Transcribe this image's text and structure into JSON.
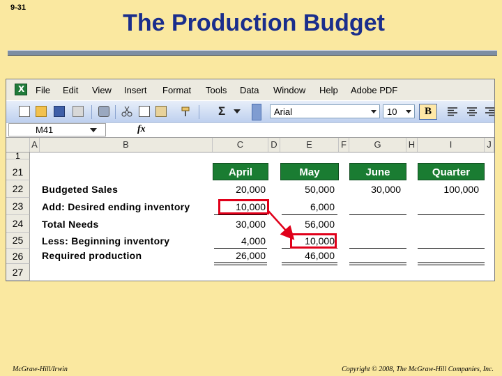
{
  "slide": {
    "number": "9-31",
    "title": "The Production Budget",
    "footer_left": "McGraw-Hill/Irwin",
    "footer_right": "Copyright © 2008, The McGraw-Hill Companies, Inc."
  },
  "menu": [
    "File",
    "Edit",
    "View",
    "Insert",
    "Format",
    "Tools",
    "Data",
    "Window",
    "Help",
    "Adobe PDF"
  ],
  "toolbar": {
    "font": "Arial",
    "size": "10",
    "bold_label": "B",
    "sigma": "Σ"
  },
  "formula_bar": {
    "cell_ref": "M41",
    "fx": "fx",
    "value": ""
  },
  "columns": [
    "A",
    "B",
    "C",
    "D",
    "E",
    "F",
    "G",
    "H",
    "I",
    "J"
  ],
  "rows": [
    "1",
    "21",
    "22",
    "23",
    "24",
    "25",
    "26",
    "27"
  ],
  "headers": [
    "April",
    "May",
    "June",
    "Quarter"
  ],
  "labels": {
    "budgeted_sales": "Budgeted Sales",
    "desired_ending": "Add: Desired ending inventory",
    "total_needs": "Total Needs",
    "beginning_inventory": "Less: Beginning inventory",
    "required_production": "Required production"
  },
  "values": {
    "budgeted_sales": [
      "20,000",
      "50,000",
      "30,000",
      "100,000"
    ],
    "desired_ending": [
      "10,000",
      "6,000",
      "",
      ""
    ],
    "total_needs": [
      "30,000",
      "56,000",
      "",
      ""
    ],
    "beginning_inventory": [
      "4,000",
      "10,000",
      "",
      ""
    ],
    "required_production": [
      "26,000",
      "46,000",
      "",
      ""
    ]
  },
  "colors": {
    "background": "#fae8a0",
    "title": "#1a2e8c",
    "header_fill": "#1a7c32",
    "highlight": "#e0001a"
  }
}
